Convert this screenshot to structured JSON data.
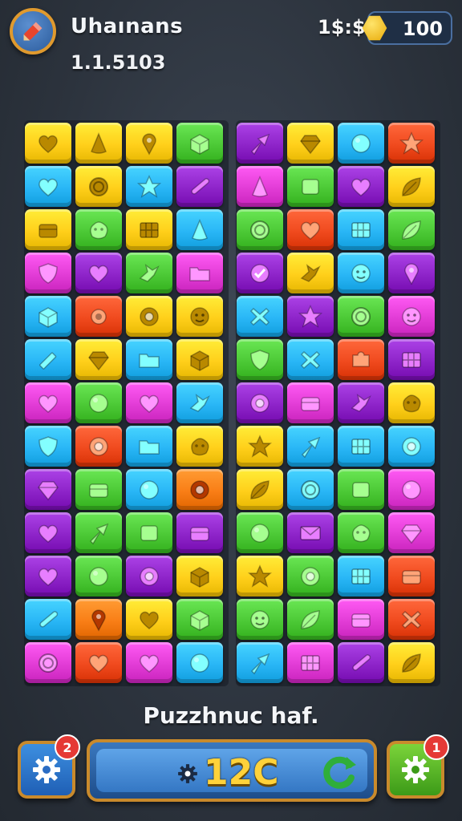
{
  "header": {
    "title": "Uhaınans",
    "subtitle": "1.1.5103",
    "currency_label": "1$:$",
    "coins": "100",
    "logo_icon": "pencil-icon",
    "coin_icon": "gold-coin-icon"
  },
  "boards": [
    {
      "name": "left",
      "tiles": [
        {
          "color": "#ffcf1a",
          "icon": "heart"
        },
        {
          "color": "#ffcf1a",
          "icon": "cone"
        },
        {
          "color": "#ffcf1a",
          "icon": "pin"
        },
        {
          "color": "#4cc936",
          "icon": "box"
        },
        {
          "color": "#29b6f6",
          "icon": "heart"
        },
        {
          "color": "#ffcf1a",
          "icon": "coin"
        },
        {
          "color": "#29b6f6",
          "icon": "star"
        },
        {
          "color": "#8e24c9",
          "icon": "stick"
        },
        {
          "color": "#ffcf1a",
          "icon": "chest"
        },
        {
          "color": "#4cc936",
          "icon": "blob"
        },
        {
          "color": "#ffcf1a",
          "icon": "grid"
        },
        {
          "color": "#29b6f6",
          "icon": "cone"
        },
        {
          "color": "#e23cd6",
          "icon": "shield"
        },
        {
          "color": "#8e24c9",
          "icon": "heart"
        },
        {
          "color": "#4cc936",
          "icon": "bird"
        },
        {
          "color": "#e23cd6",
          "icon": "folder"
        },
        {
          "color": "#29b6f6",
          "icon": "box"
        },
        {
          "color": "#f04a1e",
          "icon": "gear"
        },
        {
          "color": "#ffcf1a",
          "icon": "ring"
        },
        {
          "color": "#ffcf1a",
          "icon": "face"
        },
        {
          "color": "#29b6f6",
          "icon": "pencil"
        },
        {
          "color": "#ffcf1a",
          "icon": "gem"
        },
        {
          "color": "#29b6f6",
          "icon": "folder"
        },
        {
          "color": "#ffcf1a",
          "icon": "box"
        },
        {
          "color": "#e23cd6",
          "icon": "heart"
        },
        {
          "color": "#4cc936",
          "icon": "ball"
        },
        {
          "color": "#e23cd6",
          "icon": "heart"
        },
        {
          "color": "#29b6f6",
          "icon": "bird"
        },
        {
          "color": "#29b6f6",
          "icon": "shield"
        },
        {
          "color": "#f04a1e",
          "icon": "ring"
        },
        {
          "color": "#29b6f6",
          "icon": "folder"
        },
        {
          "color": "#ffcf1a",
          "icon": "blob"
        },
        {
          "color": "#8e24c9",
          "icon": "gem"
        },
        {
          "color": "#4cc936",
          "icon": "chest"
        },
        {
          "color": "#29b6f6",
          "icon": "ball"
        },
        {
          "color": "#f97e16",
          "icon": "ring"
        },
        {
          "color": "#8e24c9",
          "icon": "heart"
        },
        {
          "color": "#4cc936",
          "icon": "arrow"
        },
        {
          "color": "#4cc936",
          "icon": "square"
        },
        {
          "color": "#8e24c9",
          "icon": "chest"
        },
        {
          "color": "#8e24c9",
          "icon": "heart"
        },
        {
          "color": "#4cc936",
          "icon": "ball"
        },
        {
          "color": "#8e24c9",
          "icon": "ring"
        },
        {
          "color": "#ffcf1a",
          "icon": "box"
        },
        {
          "color": "#29b6f6",
          "icon": "stick"
        },
        {
          "color": "#f97e16",
          "icon": "pin"
        },
        {
          "color": "#ffcf1a",
          "icon": "heart"
        },
        {
          "color": "#4cc936",
          "icon": "box"
        },
        {
          "color": "#e23cd6",
          "icon": "coin"
        },
        {
          "color": "#f04a1e",
          "icon": "heart"
        },
        {
          "color": "#e23cd6",
          "icon": "heart"
        },
        {
          "color": "#29b6f6",
          "icon": "ball"
        }
      ]
    },
    {
      "name": "right",
      "tiles": [
        {
          "color": "#8e24c9",
          "icon": "arrow"
        },
        {
          "color": "#ffcf1a",
          "icon": "gem"
        },
        {
          "color": "#29b6f6",
          "icon": "ball"
        },
        {
          "color": "#f04a1e",
          "icon": "star"
        },
        {
          "color": "#e23cd6",
          "icon": "cone"
        },
        {
          "color": "#4cc936",
          "icon": "square"
        },
        {
          "color": "#8e24c9",
          "icon": "heart"
        },
        {
          "color": "#ffcf1a",
          "icon": "leaf"
        },
        {
          "color": "#4cc936",
          "icon": "coin"
        },
        {
          "color": "#f04a1e",
          "icon": "heart"
        },
        {
          "color": "#29b6f6",
          "icon": "grid"
        },
        {
          "color": "#4cc936",
          "icon": "leaf"
        },
        {
          "color": "#8e24c9",
          "icon": "check"
        },
        {
          "color": "#ffcf1a",
          "icon": "bird"
        },
        {
          "color": "#29b6f6",
          "icon": "face"
        },
        {
          "color": "#8e24c9",
          "icon": "pin"
        },
        {
          "color": "#29b6f6",
          "icon": "cross"
        },
        {
          "color": "#8e24c9",
          "icon": "star"
        },
        {
          "color": "#4cc936",
          "icon": "coin"
        },
        {
          "color": "#e23cd6",
          "icon": "face"
        },
        {
          "color": "#4cc936",
          "icon": "shield"
        },
        {
          "color": "#29b6f6",
          "icon": "cross"
        },
        {
          "color": "#f04a1e",
          "icon": "puzzle"
        },
        {
          "color": "#8e24c9",
          "icon": "grid"
        },
        {
          "color": "#8e24c9",
          "icon": "ring"
        },
        {
          "color": "#e23cd6",
          "icon": "chest"
        },
        {
          "color": "#8e24c9",
          "icon": "bird"
        },
        {
          "color": "#ffcf1a",
          "icon": "blob"
        },
        {
          "color": "#ffcf1a",
          "icon": "star"
        },
        {
          "color": "#29b6f6",
          "icon": "arrow"
        },
        {
          "color": "#29b6f6",
          "icon": "grid"
        },
        {
          "color": "#29b6f6",
          "icon": "ring"
        },
        {
          "color": "#ffcf1a",
          "icon": "leaf"
        },
        {
          "color": "#29b6f6",
          "icon": "coin"
        },
        {
          "color": "#4cc936",
          "icon": "square"
        },
        {
          "color": "#e23cd6",
          "icon": "ball"
        },
        {
          "color": "#4cc936",
          "icon": "ball"
        },
        {
          "color": "#8e24c9",
          "icon": "envelope"
        },
        {
          "color": "#4cc936",
          "icon": "blob"
        },
        {
          "color": "#e23cd6",
          "icon": "gem"
        },
        {
          "color": "#ffcf1a",
          "icon": "star"
        },
        {
          "color": "#4cc936",
          "icon": "ring"
        },
        {
          "color": "#29b6f6",
          "icon": "grid"
        },
        {
          "color": "#f04a1e",
          "icon": "chest"
        },
        {
          "color": "#4cc936",
          "icon": "face"
        },
        {
          "color": "#4cc936",
          "icon": "leaf"
        },
        {
          "color": "#e23cd6",
          "icon": "chest"
        },
        {
          "color": "#f04a1e",
          "icon": "cross"
        },
        {
          "color": "#29b6f6",
          "icon": "arrow"
        },
        {
          "color": "#e23cd6",
          "icon": "grid"
        },
        {
          "color": "#8e24c9",
          "icon": "stick"
        },
        {
          "color": "#ffcf1a",
          "icon": "leaf"
        }
      ]
    }
  ],
  "footer": {
    "caption": "Puzzhnuc haf.",
    "score": "12C",
    "left_button": {
      "icon": "gear-icon",
      "badge": "2"
    },
    "right_button": {
      "icon": "gear-icon",
      "badge": "1"
    },
    "score_icon": "gear-icon",
    "refresh_icon": "refresh-icon"
  }
}
